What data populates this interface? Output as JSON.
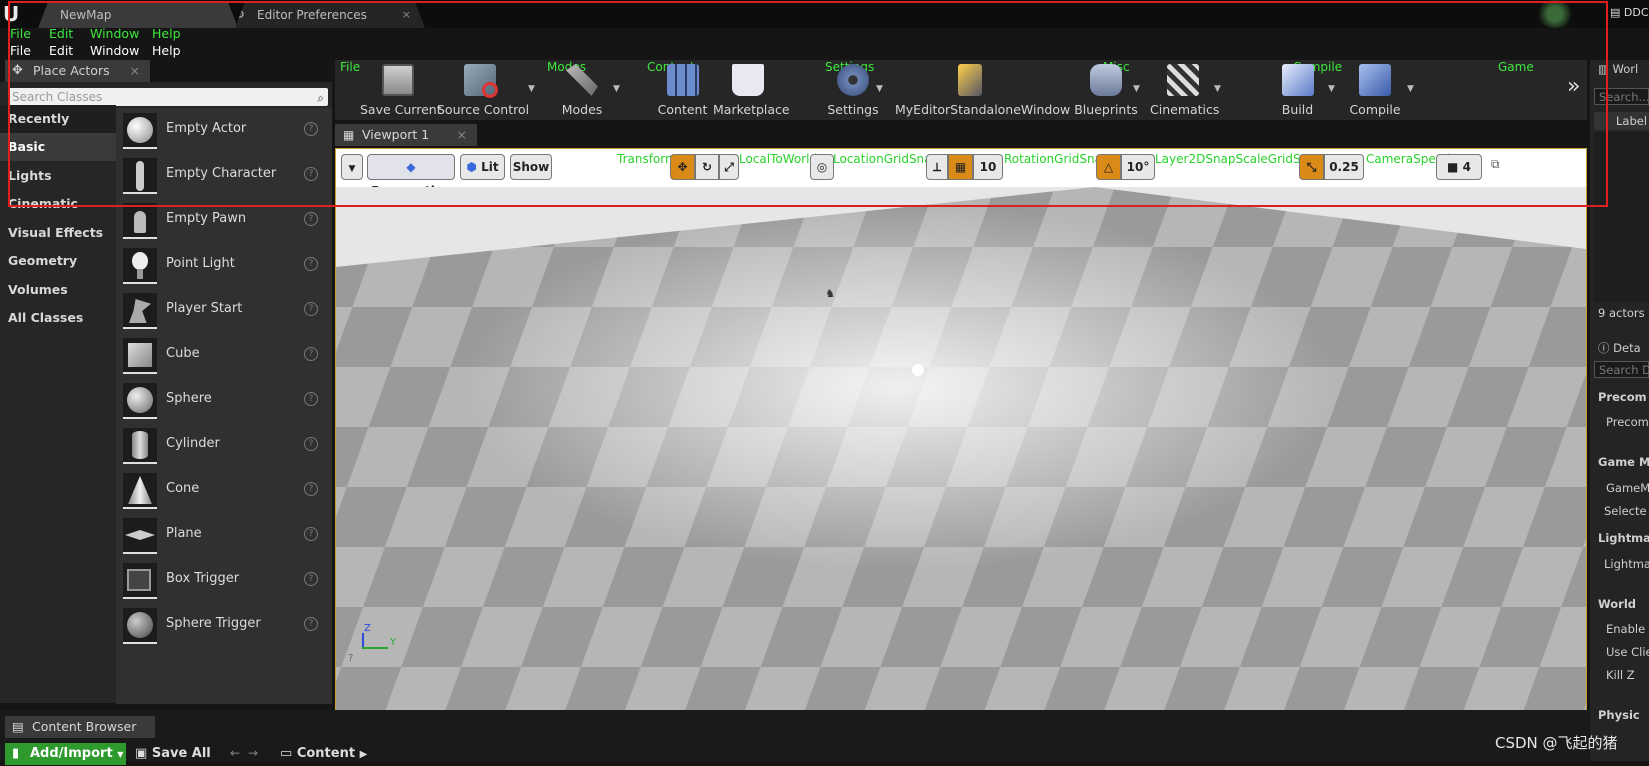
{
  "tabs": {
    "map": "NewMap",
    "prefs": "Editor Preferences",
    "close": "×"
  },
  "menu_green": {
    "file": "File",
    "edit": "Edit",
    "window": "Window",
    "help": "Help"
  },
  "menu_white": {
    "file": "File",
    "edit": "Edit",
    "window": "Window",
    "help": "Help"
  },
  "toolbar": {
    "section_labels": {
      "file": "File",
      "modes": "Modes",
      "content": "Content",
      "settings": "Settings",
      "misc": "Misc",
      "compile": "Compile",
      "game": "Game"
    },
    "buttons": {
      "save_current": "Save Current",
      "source_control": "Source Control",
      "modes": "Modes",
      "content": "Content",
      "marketplace": "Marketplace",
      "settings": "Settings",
      "my_editor": "MyEditorStandaloneWindow",
      "blueprints": "Blueprints",
      "cinematics": "Cinematics",
      "build": "Build",
      "compile": "Compile"
    },
    "overflow": "»"
  },
  "place_actors": {
    "tab_title": "Place Actors",
    "close": "×",
    "search_placeholder": "Search Classes",
    "categories": [
      "Recently Placed",
      "Basic",
      "Lights",
      "Cinematic",
      "Visual Effects",
      "Geometry",
      "Volumes",
      "All Classes"
    ],
    "selected_category": "Basic",
    "actors": [
      "Empty Actor",
      "Empty Character",
      "Empty Pawn",
      "Point Light",
      "Player Start",
      "Cube",
      "Sphere",
      "Cylinder",
      "Cone",
      "Plane",
      "Box Trigger",
      "Sphere Trigger"
    ]
  },
  "viewport": {
    "tab_title": "Viewport 1",
    "close": "×",
    "perspective": "Perspective",
    "lit": "Lit",
    "show": "Show",
    "green_labels": {
      "transform": "Transform",
      "local_to_world": "LocalToWorld",
      "location_grid_snap": "LocationGridSnap",
      "rotation_grid_snap": "RotationGridSnap",
      "layer2d": "Layer2DSnapScaleGridSnap",
      "camera_speed": "CameraSpeed"
    },
    "grid_snap_value": "10",
    "rotation_snap_value": "10°",
    "scale_snap_value": "0.25",
    "camera_speed_value": "4",
    "axis_z": "Z",
    "axis_y": "Y"
  },
  "right_panel": {
    "world_tab": "Worl",
    "search": "Search...",
    "label_col": "Label",
    "actor_count": "9 actors",
    "details_tab": "Deta",
    "details_search": "Search D",
    "precomputed": "Precom",
    "precomputed_item": "Precom",
    "game_mode": "Game M",
    "game_mode_item": "GameM",
    "selected": "Selecte",
    "lightmass": "Lightma",
    "lightmass_item": "Lightma",
    "world": "World",
    "enable": "Enable W",
    "use_client": "Use Clie",
    "kill_z": "Kill Z",
    "physics": "Physic",
    "ddc": "DDC"
  },
  "content_browser": {
    "tab_title": "Content Browser",
    "close": "×",
    "add_import": "Add/Import",
    "save_all": "Save All",
    "path": "Content"
  },
  "watermark": "CSDN @飞起的猪"
}
